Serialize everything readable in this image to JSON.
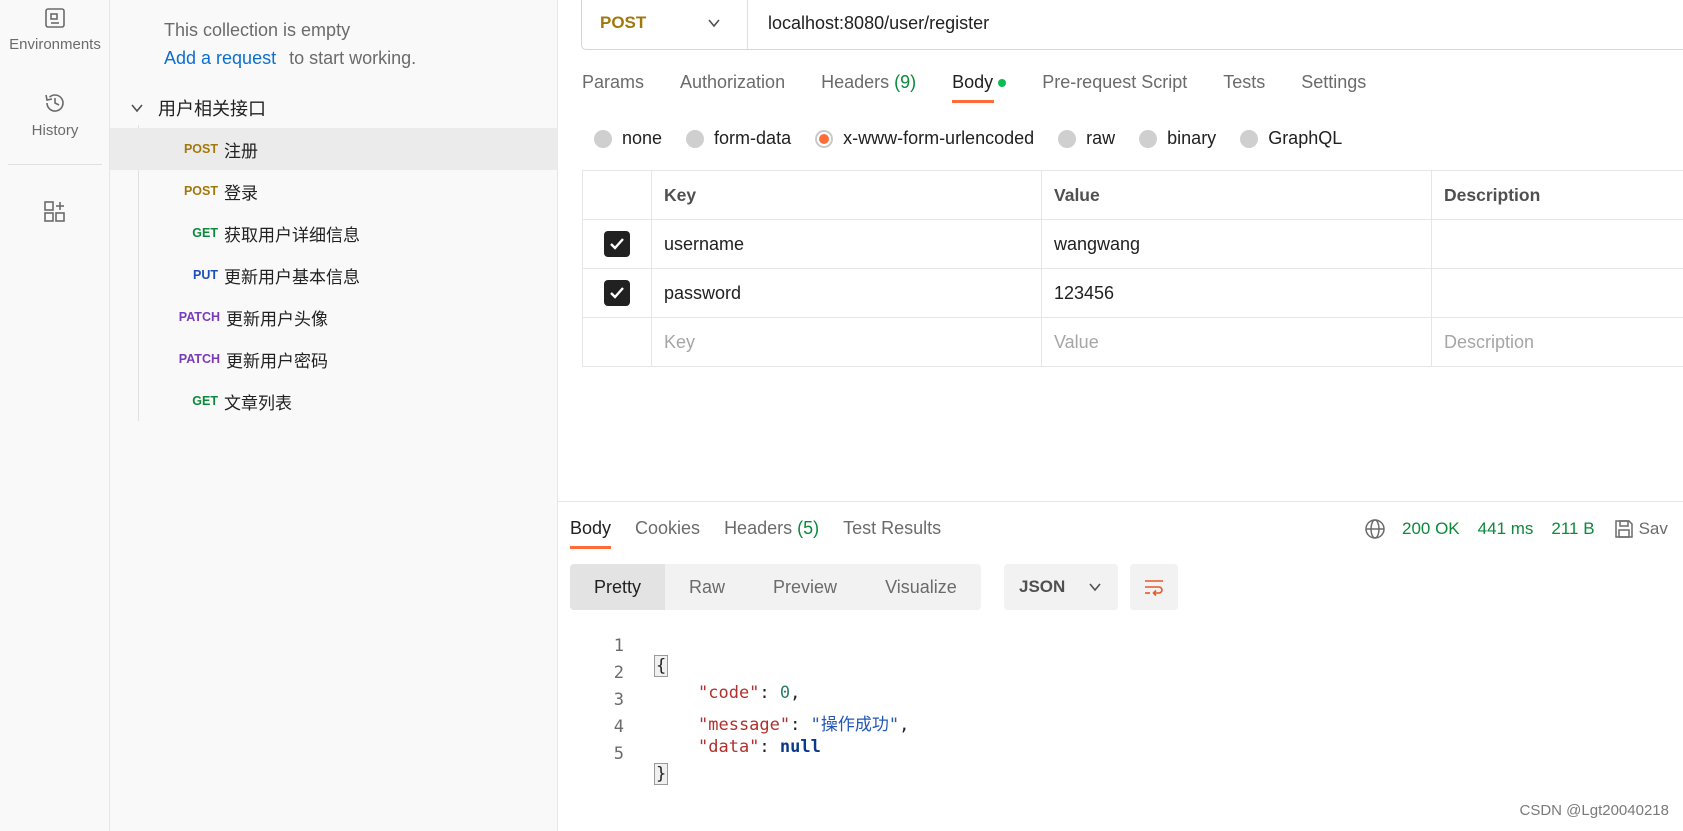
{
  "rail": {
    "environments_label": "Environments",
    "history_label": "History"
  },
  "sidebar": {
    "empty_message": "This collection is empty",
    "add_request_link": "Add a request",
    "add_request_suffix": "to start working.",
    "folder_name": "用户相关接口",
    "requests": [
      {
        "method": "POST",
        "name": "注册",
        "active": true
      },
      {
        "method": "POST",
        "name": "登录",
        "active": false
      },
      {
        "method": "GET",
        "name": "获取用户详细信息",
        "active": false
      },
      {
        "method": "PUT",
        "name": "更新用户基本信息",
        "active": false
      },
      {
        "method": "PATCH",
        "name": "更新用户头像",
        "active": false
      },
      {
        "method": "PATCH",
        "name": "更新用户密码",
        "active": false
      },
      {
        "method": "GET",
        "name": "文章列表",
        "active": false
      }
    ]
  },
  "request": {
    "method": "POST",
    "url": "localhost:8080/user/register",
    "tabs": {
      "params": "Params",
      "authorization": "Authorization",
      "headers": "Headers",
      "headers_count": "(9)",
      "body": "Body",
      "pre_request": "Pre-request Script",
      "tests": "Tests",
      "settings": "Settings"
    },
    "body_types": {
      "none": "none",
      "form_data": "form-data",
      "urlencoded": "x-www-form-urlencoded",
      "raw": "raw",
      "binary": "binary",
      "graphql": "GraphQL"
    },
    "table": {
      "headers": {
        "key": "Key",
        "value": "Value",
        "description": "Description"
      },
      "rows": [
        {
          "key": "username",
          "value": "wangwang",
          "description": ""
        },
        {
          "key": "password",
          "value": "123456",
          "description": ""
        }
      ],
      "placeholder": {
        "key": "Key",
        "value": "Value",
        "description": "Description"
      }
    }
  },
  "response": {
    "tabs": {
      "body": "Body",
      "cookies": "Cookies",
      "headers": "Headers",
      "headers_count": "(5)",
      "test_results": "Test Results"
    },
    "status": "200 OK",
    "time": "441 ms",
    "size": "211 B",
    "save_label": "Sav",
    "views": {
      "pretty": "Pretty",
      "raw": "Raw",
      "preview": "Preview",
      "visualize": "Visualize"
    },
    "format": "JSON",
    "code": {
      "line_numbers": [
        "1",
        "2",
        "3",
        "4",
        "5"
      ],
      "open_brace": "{",
      "close_brace": "}",
      "code_key": "\"code\"",
      "code_value": "0",
      "message_key": "\"message\"",
      "message_value": "\"操作成功\"",
      "data_key": "\"data\"",
      "data_value": "null"
    }
  },
  "watermark": "CSDN @Lgt20040218",
  "colors": {
    "accent": "#ff6c37",
    "post": "#a2780c",
    "get": "#0a8a3a",
    "put": "#1d4fb8",
    "patch": "#7a3bb8",
    "status_ok": "#0a8a3a"
  }
}
